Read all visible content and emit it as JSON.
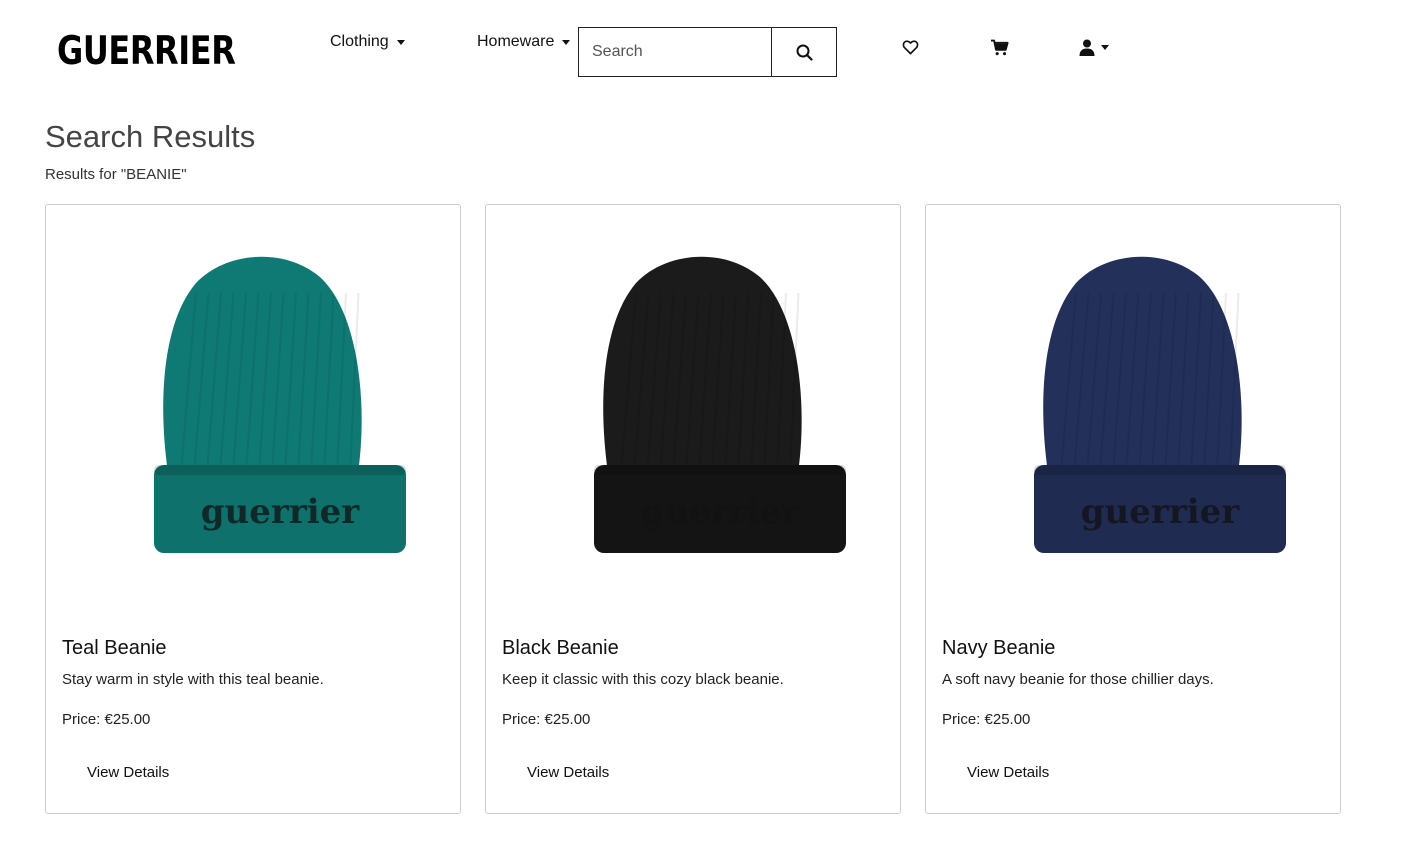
{
  "header": {
    "logo": "GUERRIER",
    "nav": [
      {
        "label": "Clothing"
      },
      {
        "label": "Homeware"
      }
    ],
    "search": {
      "placeholder": "Search",
      "value": ""
    },
    "icons": [
      "heart-icon",
      "cart-icon",
      "user-icon"
    ]
  },
  "main": {
    "title": "Search Results",
    "subtitle": "Results for \"BEANIE\"",
    "products": [
      {
        "name": "Teal Beanie",
        "description": "Stay warm in style with this teal beanie.",
        "price": "Price: €25.00",
        "link": "View Details",
        "color": "#0f7a74",
        "cuff": "#0e716b",
        "wordmark": "guerrier"
      },
      {
        "name": "Black Beanie",
        "description": "Keep it classic with this cozy black beanie.",
        "price": "Price: €25.00",
        "link": "View Details",
        "color": "#1b1b1b",
        "cuff": "#141414",
        "wordmark": "guerrier"
      },
      {
        "name": "Navy Beanie",
        "description": "A soft navy beanie for those chillier days.",
        "price": "Price: €25.00",
        "link": "View Details",
        "color": "#22305a",
        "cuff": "#1f2b50",
        "wordmark": "guerrier"
      }
    ]
  }
}
